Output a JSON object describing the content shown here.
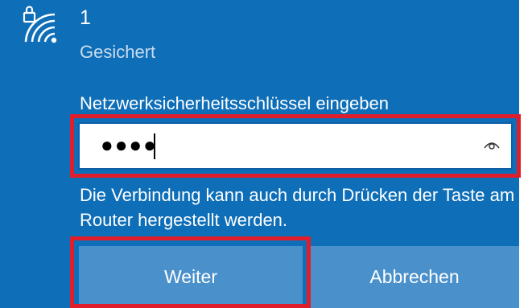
{
  "network": {
    "name": "1",
    "status": "Gesichert",
    "icon": "secured-wifi-icon"
  },
  "password": {
    "label": "Netzwerksicherheitsschlüssel eingeben",
    "value": "●●●●",
    "reveal_icon": "eye-icon"
  },
  "hint": "Die Verbindung kann auch durch Drücken der Taste am Router hergestellt werden.",
  "buttons": {
    "next": "Weiter",
    "cancel": "Abbrechen"
  },
  "colors": {
    "panel": "#0e6eb8",
    "button": "#4a90cb",
    "highlight": "#e01e2b"
  }
}
